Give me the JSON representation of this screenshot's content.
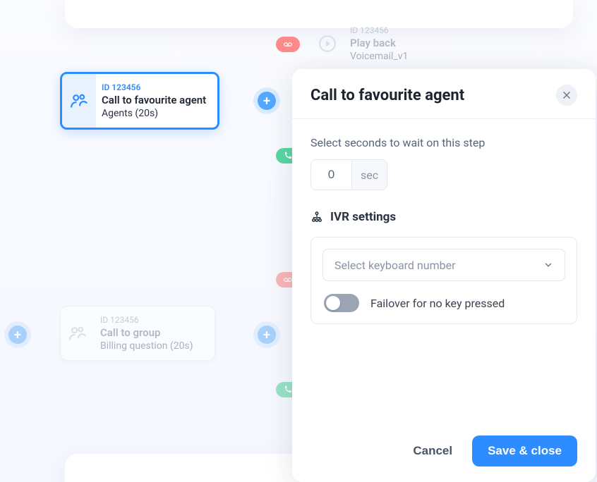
{
  "flow": {
    "node_selected": {
      "id": "ID 123456",
      "title": "Call to favourite agent",
      "subtitle": "Agents (20s)"
    },
    "node_playback": {
      "id": "ID 123456",
      "title": "Play back",
      "subtitle": "Voicemail_v1"
    },
    "node_group": {
      "id": "ID 123456",
      "title": "Call to group",
      "subtitle": "Billing question (20s)"
    }
  },
  "panel": {
    "title": "Call to favourite agent",
    "wait_label": "Select seconds to wait on this step",
    "wait_value": "0",
    "wait_suffix": "sec",
    "ivr_heading": "IVR  settings",
    "select_placeholder": "Select  keyboard number",
    "failover_label": "Failover for no key pressed",
    "cancel": "Cancel",
    "save": "Save & close"
  }
}
